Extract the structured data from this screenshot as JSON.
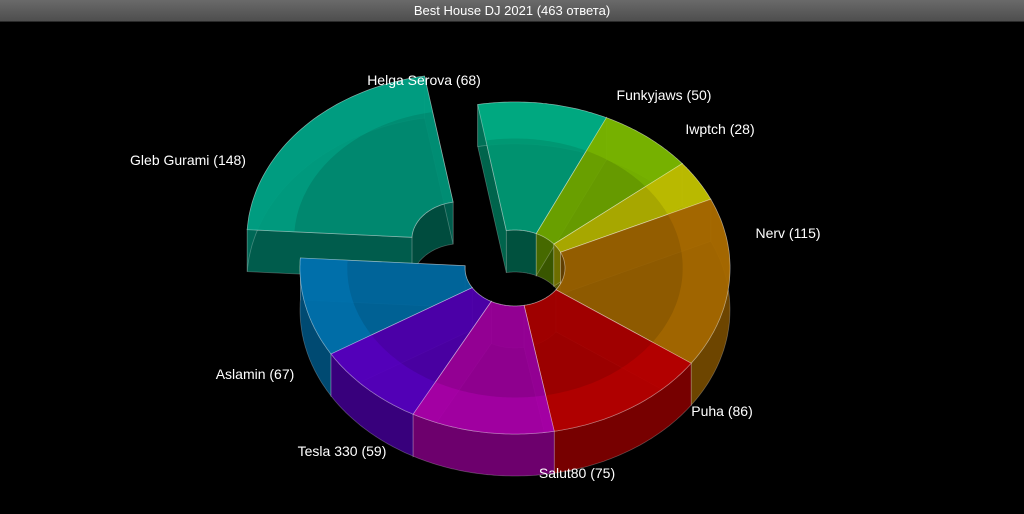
{
  "window": {
    "title": "Best House DJ 2021 (463 ответа)"
  },
  "chart_data": {
    "type": "pie",
    "variant": "3d-donut",
    "title": "Best House DJ 2021 (463 ответа)",
    "exploded_slice": "Gleb Gurami",
    "slices": [
      {
        "name": "Helga Serova",
        "value": 68,
        "label": "Helga Serova (68)",
        "color": "#00b58a"
      },
      {
        "name": "Funkyjaws",
        "value": 50,
        "label": "Funkyjaws (50)",
        "color": "#7fbf00"
      },
      {
        "name": "Iwptch",
        "value": 28,
        "label": "Iwptch (28)",
        "color": "#c8c800"
      },
      {
        "name": "Nerv",
        "value": 115,
        "label": "Nerv (115)",
        "color": "#b07000"
      },
      {
        "name": "Puha",
        "value": 86,
        "label": "Puha (86)",
        "color": "#c00000"
      },
      {
        "name": "Salut80",
        "value": 75,
        "label": "Salut80 (75)",
        "color": "#b000b0"
      },
      {
        "name": "Tesla 330",
        "value": 59,
        "label": "Tesla 330 (59)",
        "color": "#5a00c8"
      },
      {
        "name": "Aslamin",
        "value": 67,
        "label": "Aslamin (67)",
        "color": "#0078b8"
      },
      {
        "name": "Gleb Gurami",
        "value": 148,
        "label": "Gleb Gurami (148)",
        "color": "#00a88a"
      }
    ]
  }
}
